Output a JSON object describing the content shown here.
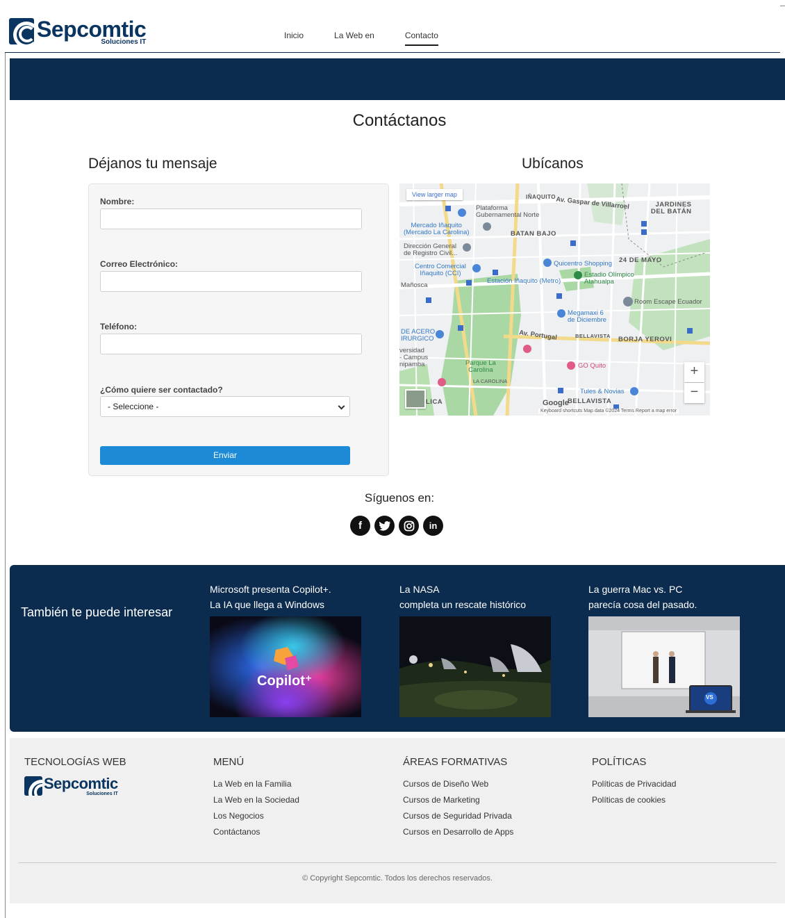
{
  "header": {
    "logo_name": "Sepcomtic",
    "logo_sub": "Soluciones IT",
    "nav": [
      {
        "label": "Inicio"
      },
      {
        "label": "La Web en"
      },
      {
        "label": "Contacto"
      }
    ],
    "active_nav": "Contacto"
  },
  "main": {
    "title": "Contáctanos",
    "form_title": "Déjanos tu mensaje",
    "map_title": "Ubícanos"
  },
  "form": {
    "name_label": "Nombre:",
    "name_value": "",
    "email_label": "Correo Electrónico:",
    "email_value": "",
    "phone_label": "Teléfono:",
    "phone_value": "",
    "contact_label": "¿Cómo quiere ser contactado?",
    "contact_selected": "- Seleccione -",
    "submit_label": "Enviar"
  },
  "map": {
    "view_larger": "View larger map",
    "labels": {
      "inaquito": "IÑAQUITO",
      "gaspar": "Av. Gaspar de Villarroel",
      "jardines": "JARDINES\nDEL BATÁN",
      "plataforma": "Plataforma\nGubernamental Norte",
      "mercado": "Mercado Iñaquito\n(Mercado La Carolina)",
      "batan_bajo": "BATAN BAJO",
      "direccion": "Dirección General\nde Registro Civil...",
      "quicentro": "Quicentro Shopping",
      "mayo": "24 DE MAYO",
      "centro_comercial": "Centro Comercial\nIñaquito (CCI)",
      "estacion": "Estación Iñaquito (Metro)",
      "estadio": "Estadio Olímpico\nAtahualpa",
      "manosca": "Mañosca",
      "room_escape": "Room Escape Ecuador",
      "megamaxi": "Megamaxi 6\nde Diciembre",
      "acero": "DE ACERO\nIRURGICO",
      "portugal": "Av. Portugal",
      "bellavista_small": "BELLAVISTA",
      "borja": "BORJA YEROVI",
      "versidad": "versidad\n- Campus\nnipamba",
      "parque": "Parque La\nCarolina",
      "go_quito": "GO Quito",
      "la_carolina": "LA CAROLINA",
      "tules": "Tules & Novias",
      "bellavista": "BELLAVISTA",
      "lica": "LICA",
      "google": "Google"
    },
    "attribution": "Keyboard shortcuts   Map data ©2024   Terms   Report a map error",
    "zoom_in": "+",
    "zoom_out": "−"
  },
  "social": {
    "title": "Síguenos en:",
    "icons": [
      "facebook-icon",
      "twitter-icon",
      "instagram-icon",
      "linkedin-icon"
    ]
  },
  "related": {
    "title": "También te puede interesar",
    "cards": [
      {
        "title": "Microsoft presenta Copilot+.\nLa IA que llega a Windows",
        "image_text": "Copilot⁺"
      },
      {
        "title": "La NASA\ncompleta un rescate histórico"
      },
      {
        "title": "La guerra Mac vs. PC\nparecía cosa del pasado.",
        "badge": "VS"
      }
    ]
  },
  "footer": {
    "col1_title": "TECNOLOGÍAS WEB",
    "col2_title": "MENÚ",
    "col2_links": [
      "La Web en la Familia",
      "La Web en la Sociedad",
      "Los Negocios",
      "Contáctanos"
    ],
    "col3_title": "ÁREAS FORMATIVAS",
    "col3_links": [
      "Cursos de Diseño Web",
      "Cursos de Marketing",
      "Cursos de Seguridad Privada",
      "Cursos en Desarrollo de Apps"
    ],
    "col4_title": "POLÍTICAS",
    "col4_links": [
      "Políticas de Privacidad",
      "Políticas de cookies"
    ],
    "copyright": "© Copyright Sepcomtic. Todos los derechos reservados."
  },
  "colors": {
    "navy": "#0b2c4f",
    "button_blue": "#1c8ad6",
    "footer_bg": "#f0f0f0"
  }
}
